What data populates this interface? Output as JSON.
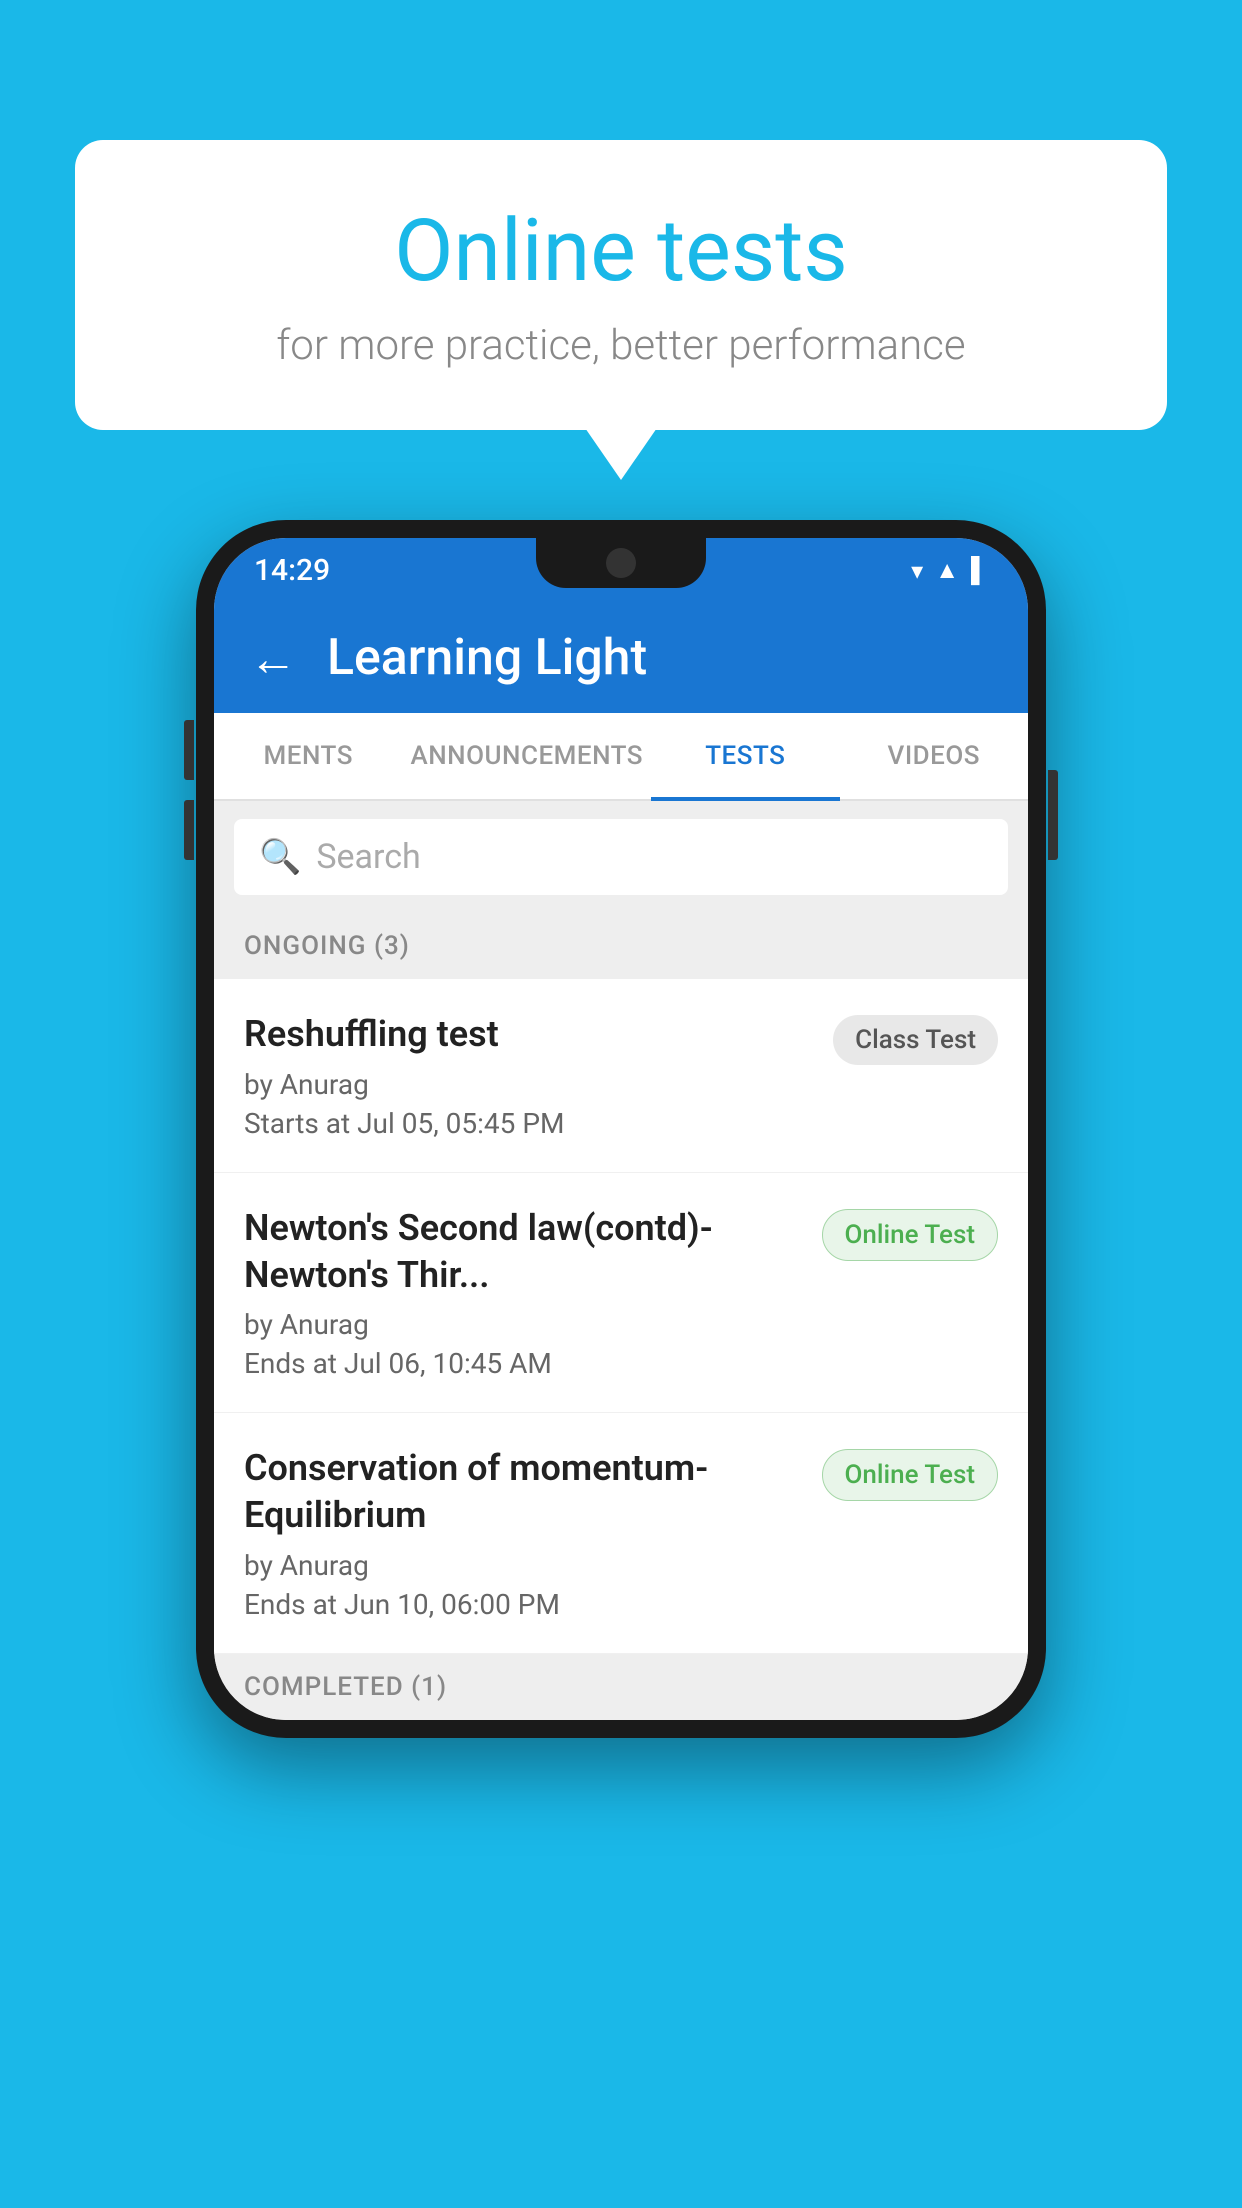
{
  "background_color": "#1ab8e8",
  "speech_bubble": {
    "title": "Online tests",
    "subtitle": "for more practice, better performance"
  },
  "phone": {
    "status_bar": {
      "time": "14:29",
      "icons": [
        "▼",
        "▲",
        "▌"
      ]
    },
    "app_bar": {
      "title": "Learning Light",
      "back_label": "←"
    },
    "tabs": [
      {
        "label": "MENTS",
        "active": false
      },
      {
        "label": "ANNOUNCEMENTS",
        "active": false
      },
      {
        "label": "TESTS",
        "active": true
      },
      {
        "label": "VIDEOS",
        "active": false
      }
    ],
    "search": {
      "placeholder": "Search"
    },
    "section_ongoing": "ONGOING (3)",
    "tests": [
      {
        "title": "Reshuffling test",
        "author": "by Anurag",
        "date": "Starts at  Jul 05, 05:45 PM",
        "badge": "Class Test",
        "badge_type": "class"
      },
      {
        "title": "Newton's Second law(contd)-Newton's Thir...",
        "author": "by Anurag",
        "date": "Ends at  Jul 06, 10:45 AM",
        "badge": "Online Test",
        "badge_type": "online"
      },
      {
        "title": "Conservation of momentum-Equilibrium",
        "author": "by Anurag",
        "date": "Ends at  Jun 10, 06:00 PM",
        "badge": "Online Test",
        "badge_type": "online"
      }
    ],
    "section_completed": "COMPLETED (1)"
  }
}
